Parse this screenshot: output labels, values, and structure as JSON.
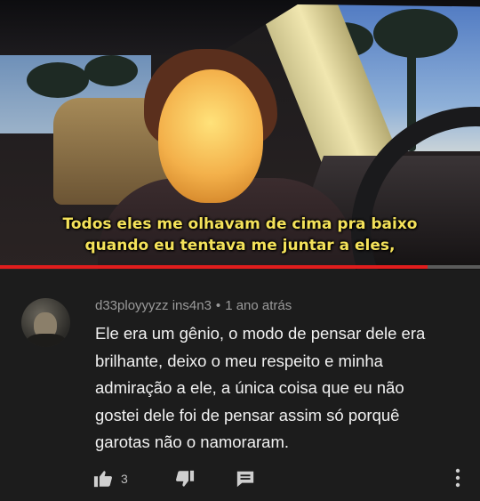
{
  "video": {
    "caption_line1": "Todos eles me olhavam de cima pra baixo",
    "caption_line2": "quando eu tentava me juntar a eles,",
    "progress": 0.89,
    "colors": {
      "caption": "#f4e25a",
      "progress": "#e11d1d"
    }
  },
  "comment": {
    "author": "d33ployyyzz ins4n3",
    "separator": "•",
    "time": "1 ano atrás",
    "lines": [
      "Ele era um gênio, o modo de pensar dele era",
      "brilhante, deixo o meu respeito e minha",
      "admiração a ele, a única coisa que eu não",
      "gostei dele foi de pensar assim só porquê",
      "garotas não o namoraram."
    ],
    "like_count": "3",
    "icons": {
      "like": "thumbs-up-icon",
      "dislike": "thumbs-down-icon",
      "reply": "reply-comment-icon",
      "more": "more-vertical-icon"
    }
  }
}
